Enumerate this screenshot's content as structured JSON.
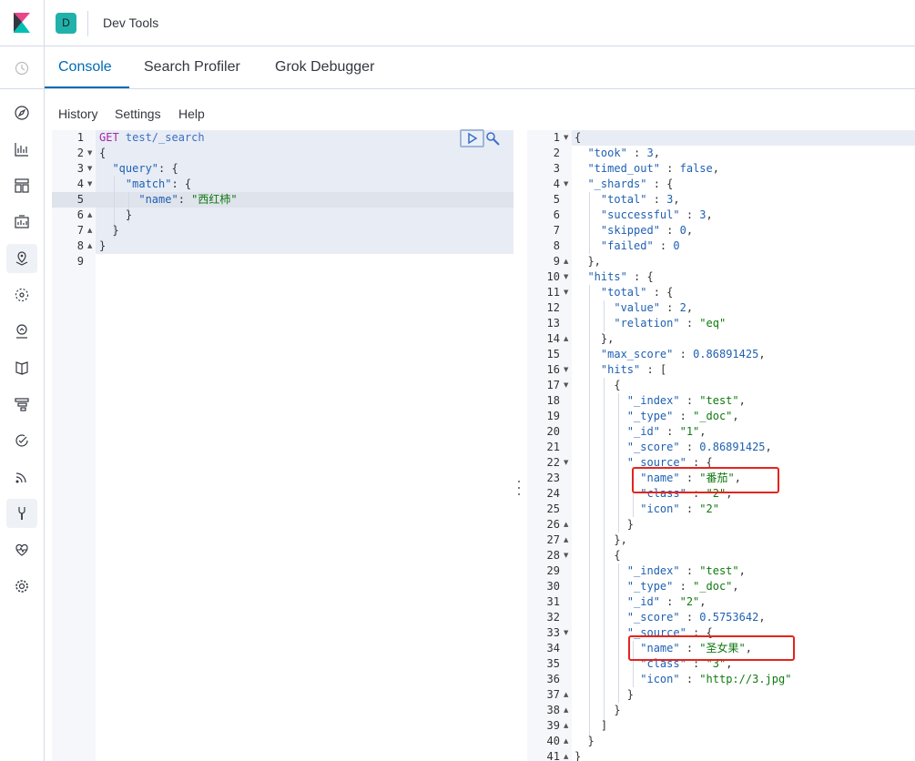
{
  "header": {
    "space_initial": "D",
    "title": "Dev Tools"
  },
  "tabs": [
    {
      "label": "Console",
      "active": true
    },
    {
      "label": "Search Profiler",
      "active": false
    },
    {
      "label": "Grok Debugger",
      "active": false
    }
  ],
  "submenu": [
    "History",
    "Settings",
    "Help"
  ],
  "nav_icons": [
    "clock-icon",
    "compass-icon",
    "visualize-icon",
    "dashboard-icon",
    "canvas-icon",
    "maps-icon",
    "ml-icon",
    "metrics-icon",
    "logs-icon",
    "apm-icon",
    "uptime-icon",
    "siem-icon",
    "devtools-icon",
    "monitoring-icon",
    "management-icon"
  ],
  "request": {
    "lines": [
      [
        [
          "GET ",
          "method"
        ],
        [
          "test/_search",
          "url"
        ]
      ],
      [
        [
          "{",
          "punc"
        ]
      ],
      [
        [
          "  ",
          "punc"
        ],
        [
          "\"query\"",
          "key"
        ],
        [
          ": {",
          "punc"
        ]
      ],
      [
        [
          "    ",
          "punc"
        ],
        [
          "\"match\"",
          "key"
        ],
        [
          ": {",
          "punc"
        ]
      ],
      [
        [
          "      ",
          "punc"
        ],
        [
          "\"name\"",
          "key"
        ],
        [
          ": ",
          "punc"
        ],
        [
          "\"西红柿\"",
          "str"
        ]
      ],
      [
        [
          "    }",
          "punc"
        ]
      ],
      [
        [
          "  }",
          "punc"
        ]
      ],
      [
        [
          "}",
          "punc"
        ]
      ],
      [
        [
          "",
          "punc"
        ]
      ]
    ]
  },
  "response": {
    "lines": [
      [
        [
          "{",
          "punc"
        ]
      ],
      [
        [
          "  ",
          "punc"
        ],
        [
          "\"took\"",
          "key"
        ],
        [
          " : ",
          "punc"
        ],
        [
          "3",
          "num"
        ],
        [
          ",",
          "punc"
        ]
      ],
      [
        [
          "  ",
          "punc"
        ],
        [
          "\"timed_out\"",
          "key"
        ],
        [
          " : ",
          "punc"
        ],
        [
          "false",
          "num"
        ],
        [
          ",",
          "punc"
        ]
      ],
      [
        [
          "  ",
          "punc"
        ],
        [
          "\"_shards\"",
          "key"
        ],
        [
          " : {",
          "punc"
        ]
      ],
      [
        [
          "    ",
          "punc"
        ],
        [
          "\"total\"",
          "key"
        ],
        [
          " : ",
          "punc"
        ],
        [
          "3",
          "num"
        ],
        [
          ",",
          "punc"
        ]
      ],
      [
        [
          "    ",
          "punc"
        ],
        [
          "\"successful\"",
          "key"
        ],
        [
          " : ",
          "punc"
        ],
        [
          "3",
          "num"
        ],
        [
          ",",
          "punc"
        ]
      ],
      [
        [
          "    ",
          "punc"
        ],
        [
          "\"skipped\"",
          "key"
        ],
        [
          " : ",
          "punc"
        ],
        [
          "0",
          "num"
        ],
        [
          ",",
          "punc"
        ]
      ],
      [
        [
          "    ",
          "punc"
        ],
        [
          "\"failed\"",
          "key"
        ],
        [
          " : ",
          "punc"
        ],
        [
          "0",
          "num"
        ]
      ],
      [
        [
          "  },",
          "punc"
        ]
      ],
      [
        [
          "  ",
          "punc"
        ],
        [
          "\"hits\"",
          "key"
        ],
        [
          " : {",
          "punc"
        ]
      ],
      [
        [
          "    ",
          "punc"
        ],
        [
          "\"total\"",
          "key"
        ],
        [
          " : {",
          "punc"
        ]
      ],
      [
        [
          "      ",
          "punc"
        ],
        [
          "\"value\"",
          "key"
        ],
        [
          " : ",
          "punc"
        ],
        [
          "2",
          "num"
        ],
        [
          ",",
          "punc"
        ]
      ],
      [
        [
          "      ",
          "punc"
        ],
        [
          "\"relation\"",
          "key"
        ],
        [
          " : ",
          "punc"
        ],
        [
          "\"eq\"",
          "str"
        ]
      ],
      [
        [
          "    },",
          "punc"
        ]
      ],
      [
        [
          "    ",
          "punc"
        ],
        [
          "\"max_score\"",
          "key"
        ],
        [
          " : ",
          "punc"
        ],
        [
          "0.86891425",
          "num"
        ],
        [
          ",",
          "punc"
        ]
      ],
      [
        [
          "    ",
          "punc"
        ],
        [
          "\"hits\"",
          "key"
        ],
        [
          " : [",
          "punc"
        ]
      ],
      [
        [
          "      {",
          "punc"
        ]
      ],
      [
        [
          "        ",
          "punc"
        ],
        [
          "\"_index\"",
          "key"
        ],
        [
          " : ",
          "punc"
        ],
        [
          "\"test\"",
          "str"
        ],
        [
          ",",
          "punc"
        ]
      ],
      [
        [
          "        ",
          "punc"
        ],
        [
          "\"_type\"",
          "key"
        ],
        [
          " : ",
          "punc"
        ],
        [
          "\"_doc\"",
          "str"
        ],
        [
          ",",
          "punc"
        ]
      ],
      [
        [
          "        ",
          "punc"
        ],
        [
          "\"_id\"",
          "key"
        ],
        [
          " : ",
          "punc"
        ],
        [
          "\"1\"",
          "str"
        ],
        [
          ",",
          "punc"
        ]
      ],
      [
        [
          "        ",
          "punc"
        ],
        [
          "\"_score\"",
          "key"
        ],
        [
          " : ",
          "punc"
        ],
        [
          "0.86891425",
          "num"
        ],
        [
          ",",
          "punc"
        ]
      ],
      [
        [
          "        ",
          "punc"
        ],
        [
          "\"_source\"",
          "key"
        ],
        [
          " : {",
          "punc"
        ]
      ],
      [
        [
          "          ",
          "punc"
        ],
        [
          "\"name\"",
          "key"
        ],
        [
          " : ",
          "punc"
        ],
        [
          "\"番茄\"",
          "str"
        ],
        [
          ",",
          "punc"
        ]
      ],
      [
        [
          "          ",
          "punc"
        ],
        [
          "\"class\"",
          "key"
        ],
        [
          " : ",
          "punc"
        ],
        [
          "\"2\"",
          "str"
        ],
        [
          ",",
          "punc"
        ]
      ],
      [
        [
          "          ",
          "punc"
        ],
        [
          "\"icon\"",
          "key"
        ],
        [
          " : ",
          "punc"
        ],
        [
          "\"2\"",
          "str"
        ]
      ],
      [
        [
          "        }",
          "punc"
        ]
      ],
      [
        [
          "      },",
          "punc"
        ]
      ],
      [
        [
          "      {",
          "punc"
        ]
      ],
      [
        [
          "        ",
          "punc"
        ],
        [
          "\"_index\"",
          "key"
        ],
        [
          " : ",
          "punc"
        ],
        [
          "\"test\"",
          "str"
        ],
        [
          ",",
          "punc"
        ]
      ],
      [
        [
          "        ",
          "punc"
        ],
        [
          "\"_type\"",
          "key"
        ],
        [
          " : ",
          "punc"
        ],
        [
          "\"_doc\"",
          "str"
        ],
        [
          ",",
          "punc"
        ]
      ],
      [
        [
          "        ",
          "punc"
        ],
        [
          "\"_id\"",
          "key"
        ],
        [
          " : ",
          "punc"
        ],
        [
          "\"2\"",
          "str"
        ],
        [
          ",",
          "punc"
        ]
      ],
      [
        [
          "        ",
          "punc"
        ],
        [
          "\"_score\"",
          "key"
        ],
        [
          " : ",
          "punc"
        ],
        [
          "0.5753642",
          "num"
        ],
        [
          ",",
          "punc"
        ]
      ],
      [
        [
          "        ",
          "punc"
        ],
        [
          "\"_source\"",
          "key"
        ],
        [
          " : {",
          "punc"
        ]
      ],
      [
        [
          "          ",
          "punc"
        ],
        [
          "\"name\"",
          "key"
        ],
        [
          " : ",
          "punc"
        ],
        [
          "\"圣女果\"",
          "str"
        ],
        [
          ",",
          "punc"
        ]
      ],
      [
        [
          "          ",
          "punc"
        ],
        [
          "\"class\"",
          "key"
        ],
        [
          " : ",
          "punc"
        ],
        [
          "\"3\"",
          "str"
        ],
        [
          ",",
          "punc"
        ]
      ],
      [
        [
          "          ",
          "punc"
        ],
        [
          "\"icon\"",
          "key"
        ],
        [
          " : ",
          "punc"
        ],
        [
          "\"http://3.jpg\"",
          "str"
        ]
      ],
      [
        [
          "        }",
          "punc"
        ]
      ],
      [
        [
          "      }",
          "punc"
        ]
      ],
      [
        [
          "    ]",
          "punc"
        ]
      ],
      [
        [
          "  }",
          "punc"
        ]
      ],
      [
        [
          "}",
          "punc"
        ]
      ]
    ]
  }
}
